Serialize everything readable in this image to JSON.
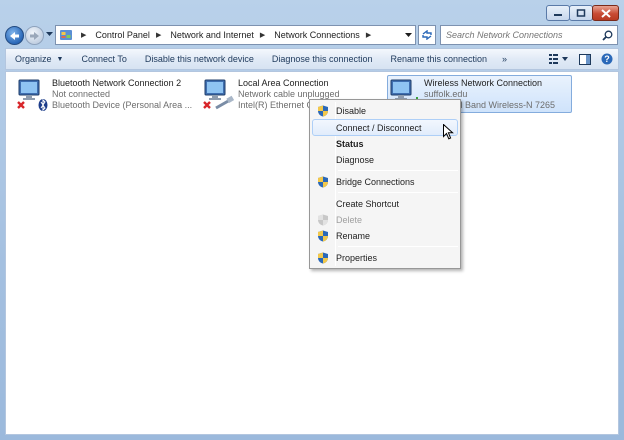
{
  "window": {
    "buttons": {
      "minimize": "minimize",
      "maximize": "maximize",
      "close": "close"
    }
  },
  "address_bar": {
    "breadcrumbs": [
      "Control Panel",
      "Network and Internet",
      "Network Connections"
    ],
    "search_placeholder": "Search Network Connections"
  },
  "toolbar": {
    "items": [
      "Organize",
      "Connect To",
      "Disable this network device",
      "Diagnose this connection",
      "Rename this connection"
    ],
    "more": "»"
  },
  "connections": [
    {
      "name": "Bluetooth Network Connection 2",
      "status": "Not connected",
      "device": "Bluetooth Device (Personal Area ..."
    },
    {
      "name": "Local Area Connection",
      "status": "Network cable unplugged",
      "device": "Intel(R) Ethernet C"
    },
    {
      "name": "Wireless Network Connection",
      "status": "suffolk.edu",
      "device": "Dual Band Wireless-N 7265"
    }
  ],
  "context_menu": {
    "items": [
      "Disable",
      "Connect / Disconnect",
      "Status",
      "Diagnose",
      "Bridge Connections",
      "Create Shortcut",
      "Delete",
      "Rename",
      "Properties"
    ]
  },
  "colors": {
    "accent": "#2a68b8",
    "selection": "#cfe3fb",
    "close_button": "#c84b34"
  }
}
